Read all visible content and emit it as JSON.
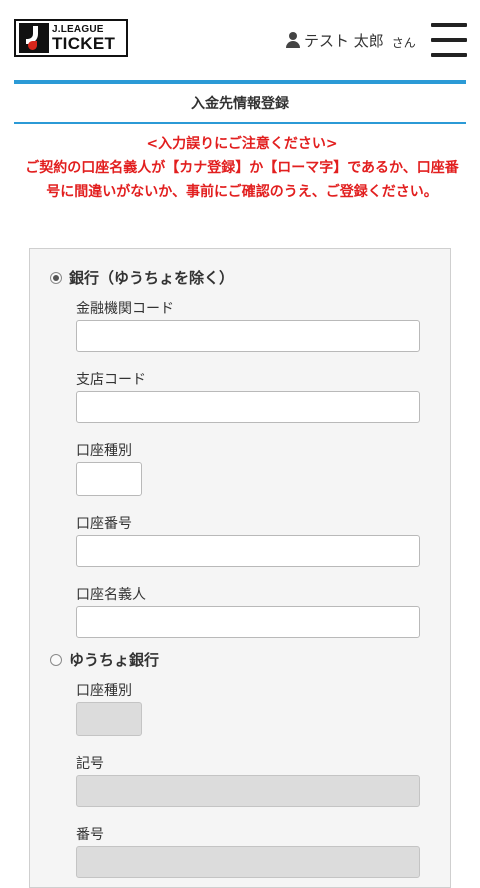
{
  "header": {
    "logo_top": "J.LEAGUE",
    "logo_bottom": "TICKET",
    "user_name": "テスト 太郎",
    "user_suffix": "さん"
  },
  "page": {
    "title": "入金先情報登録"
  },
  "warning": {
    "heading": "<入力誤りにご注意ください>",
    "body": "ご契約の口座名義人が【カナ登録】か【ローマ字】であるか、口座番号に間違いがないか、事前にご確認のうえ、ご登録ください。"
  },
  "form": {
    "bank_option": {
      "label": "銀行（ゆうちょを除く）",
      "selected": true,
      "fields": {
        "institution_code": "金融機関コード",
        "branch_code": "支店コード",
        "account_type": "口座種別",
        "account_number": "口座番号",
        "account_holder": "口座名義人"
      }
    },
    "yucho_option": {
      "label": "ゆうちょ銀行",
      "selected": false,
      "fields": {
        "account_type": "口座種別",
        "symbol": "記号",
        "number": "番号"
      }
    }
  }
}
